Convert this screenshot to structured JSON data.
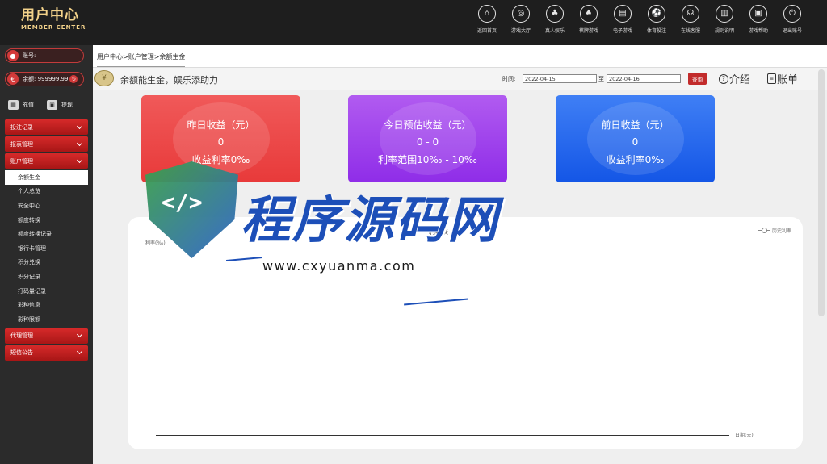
{
  "header": {
    "logo_main": "用户中心",
    "logo_sub": "MEMBER CENTER",
    "nav": [
      {
        "icon": "home-icon",
        "glyph": "⌂",
        "label": "返回首页"
      },
      {
        "icon": "lobby-icon",
        "glyph": "◎",
        "label": "游戏大厅"
      },
      {
        "icon": "live-icon",
        "glyph": "♣",
        "label": "真人娱乐"
      },
      {
        "icon": "cards-icon",
        "glyph": "♠",
        "label": "棋牌游戏"
      },
      {
        "icon": "slot-icon",
        "glyph": "▤",
        "label": "电子游戏"
      },
      {
        "icon": "sports-icon",
        "glyph": "⚽",
        "label": "体育投注"
      },
      {
        "icon": "support-icon",
        "glyph": "☊",
        "label": "在线客服"
      },
      {
        "icon": "rules-icon",
        "glyph": "▥",
        "label": "规则说明"
      },
      {
        "icon": "help-icon",
        "glyph": "▣",
        "label": "游戏帮助"
      },
      {
        "icon": "logout-icon",
        "glyph": "⏻",
        "label": "退出账号"
      }
    ]
  },
  "sidebar": {
    "account_label": "账号:",
    "balance_label": "余额: 999999.99",
    "deposit": "充值",
    "withdraw": "提现",
    "menu": [
      {
        "label": "投注记录"
      },
      {
        "label": "报表管理"
      },
      {
        "label": "账户管理"
      }
    ],
    "submenu": [
      "余额生金",
      "个人总览",
      "安全中心",
      "额度转换",
      "额度转换记录",
      "银行卡管理",
      "积分兑换",
      "积分记录",
      "打码量记录",
      "彩种信息",
      "彩种限额"
    ],
    "menu_after": [
      {
        "label": "代理管理"
      },
      {
        "label": "短信公告"
      }
    ]
  },
  "main": {
    "breadcrumb": "用户中心>账户管理>余额生金",
    "title": "余额能生金，娱乐添助力",
    "time_label": "时间:",
    "date_from": "2022-04-15",
    "to_label": "至",
    "date_to": "2022-04-16",
    "query_button": "查询",
    "intro_link": "介绍",
    "bill_link": "账单",
    "cards": [
      {
        "title": "昨日收益（元）",
        "value": "0",
        "note": "收益利率0‰",
        "color": "#e83a3a"
      },
      {
        "title": "今日预估收益（元）",
        "value": "0 - 0",
        "note": "利率范围10‰ - 10‰",
        "color": "#8f2de8"
      },
      {
        "title": "前日收益（元）",
        "value": "0",
        "note": "收益利率0‰",
        "color": "#1456e6"
      }
    ]
  },
  "chart_data": {
    "type": "line",
    "title": "利率表",
    "ylabel": "利率(‰)",
    "xlabel": "日期(天)",
    "legend": [
      "历史利率"
    ],
    "legend_position": "top-right",
    "series": [
      {
        "name": "历史利率",
        "values": []
      }
    ],
    "categories": []
  },
  "watermark": {
    "brand": "程序源码网",
    "url": "www.cxyuanma.com",
    "code_glyph": "</>"
  }
}
